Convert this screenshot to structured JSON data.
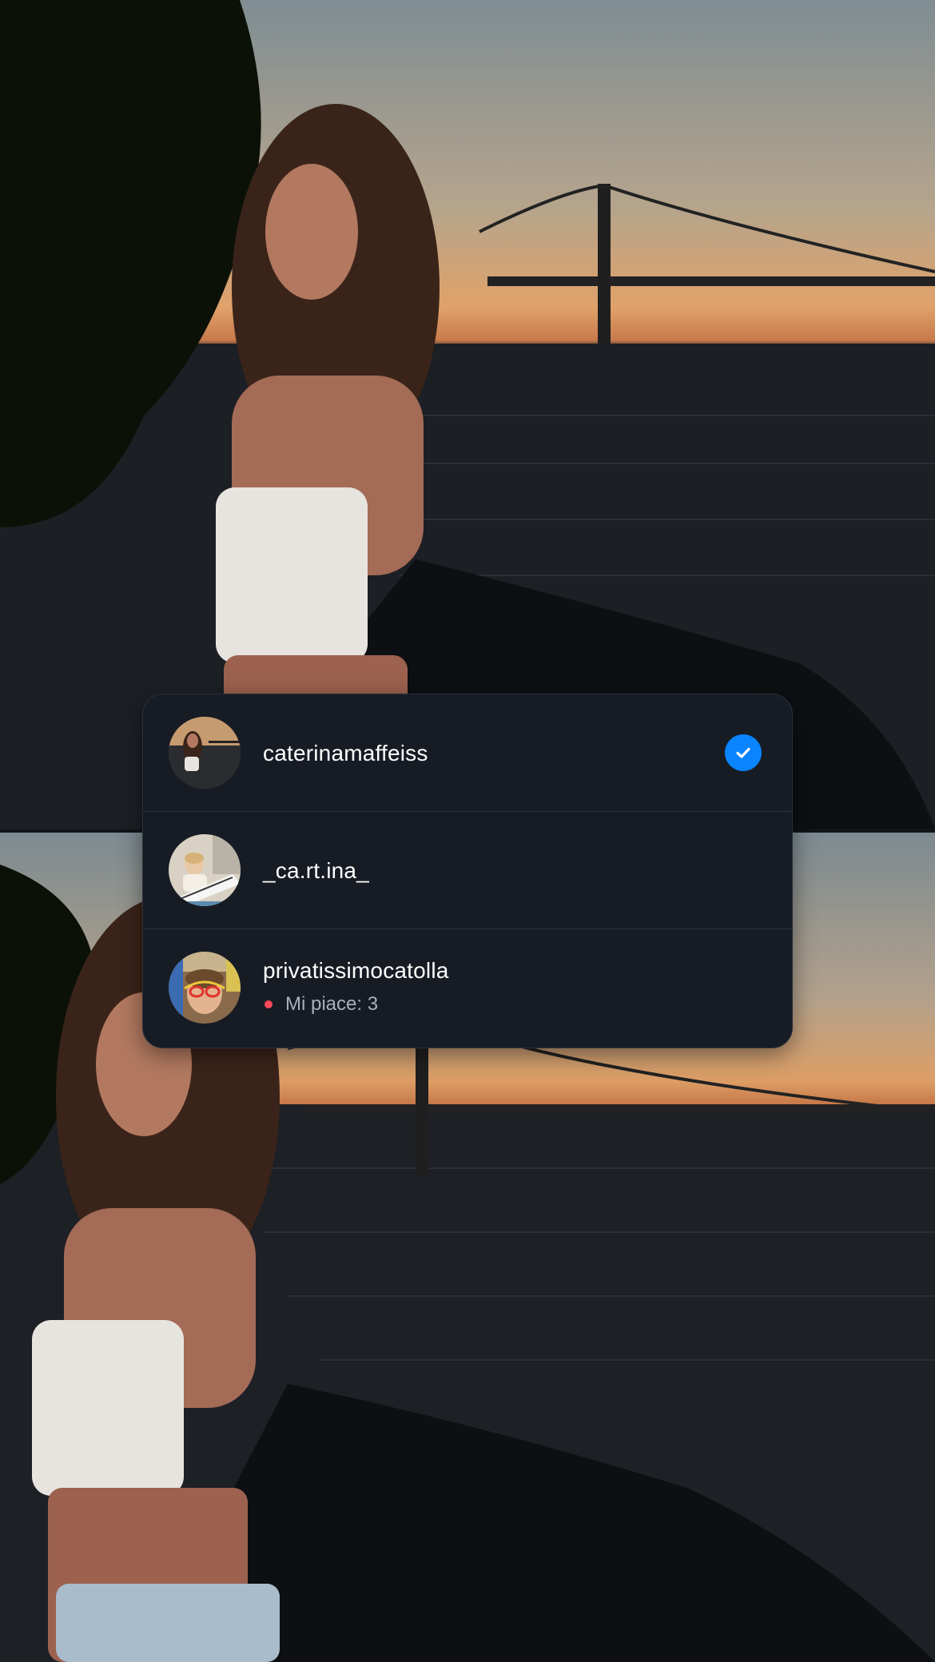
{
  "accounts": [
    {
      "username": "caterinamaffeiss",
      "selected": true,
      "icon": "check-circle-icon",
      "avatar": "avatar-sunset-photo"
    },
    {
      "username": "_ca.rt.ina_",
      "selected": false,
      "avatar": "avatar-child-piano-photo"
    },
    {
      "username": "privatissimocatolla",
      "selected": false,
      "notification": "Mi piace: 3",
      "notification_dot_color": "#ff4a5a",
      "avatar": "avatar-child-glasses-photo"
    }
  ],
  "colors": {
    "panel": "#171c24",
    "accent": "#0a84ff",
    "divider": "#2c333d"
  }
}
